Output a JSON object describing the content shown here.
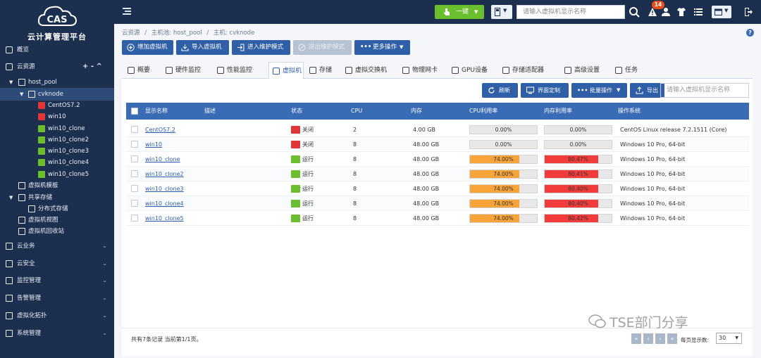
{
  "app": {
    "title": "云计算管理平台",
    "logo_text": "CAS"
  },
  "sidebar": {
    "items": [
      {
        "label": "概览",
        "icon": "home-icon"
      },
      {
        "label": "云资源",
        "icon": "cloud-resource-icon",
        "actions": "+ - ^"
      },
      {
        "label": "host_pool",
        "icon": "host-pool-icon"
      },
      {
        "label": "cvknode",
        "icon": "cvknode-icon",
        "selected": true
      },
      {
        "label": "CentOS7.2",
        "status": "stopped"
      },
      {
        "label": "win10",
        "status": "stopped"
      },
      {
        "label": "win10_clone",
        "status": "running"
      },
      {
        "label": "win10_clone2",
        "status": "running"
      },
      {
        "label": "win10_clone3",
        "status": "running"
      },
      {
        "label": "win10_clone4",
        "status": "running"
      },
      {
        "label": "win10_clone5",
        "status": "running"
      },
      {
        "label": "虚拟机模板"
      },
      {
        "label": "共享存储"
      },
      {
        "label": "分布式存储"
      },
      {
        "label": "虚拟机视图"
      },
      {
        "label": "虚拟机回收站"
      },
      {
        "label": "云业务"
      },
      {
        "label": "云安全"
      },
      {
        "label": "监控管理"
      },
      {
        "label": "告警管理"
      },
      {
        "label": "虚拟化拓扑"
      },
      {
        "label": "系统管理"
      }
    ]
  },
  "topbar": {
    "one_key": "一键",
    "search_placeholder": "请输入虚拟机显示名称",
    "alert_count": "14"
  },
  "breadcrumb": [
    "云资源",
    "/",
    "主机池: host_pool",
    "/",
    "主机: cvknode"
  ],
  "toolbar": {
    "add_vm": "增加虚拟机",
    "import_vm": "导入虚拟机",
    "enter_maintenance": "进入维护模式",
    "exit_maintenance": "退出维护模式",
    "more_ops": "更多操作"
  },
  "tabs": [
    "概要",
    "硬件监控",
    "性能监控",
    "虚拟机",
    "存储",
    "虚拟交换机",
    "物理网卡",
    "GPU设备",
    "存储适配器",
    "高级设置",
    "任务"
  ],
  "panel": {
    "refresh": "刷新",
    "ui_custom": "界面定制",
    "batch_ops": "批量操作",
    "export": "导出",
    "search_placeholder": "请输入虚拟机显示名称"
  },
  "table": {
    "headers": [
      "显示名称",
      "描述",
      "状态",
      "CPU",
      "内存",
      "CPU利用率",
      "内存利用率",
      "操作系统"
    ],
    "rows": [
      {
        "name": "CentOS7.2",
        "desc": "",
        "status": "关闭",
        "cpu": "2",
        "mem": "4.00 GB",
        "cpu_util": "0.00%",
        "cpu_pct": 0,
        "mem_util": "0.00%",
        "mem_pct": 0,
        "os": "CentOS Linux release 7.2.1511 (Core)"
      },
      {
        "name": "win10",
        "desc": "",
        "status": "关闭",
        "cpu": "8",
        "mem": "48.00 GB",
        "cpu_util": "0.00%",
        "cpu_pct": 0,
        "mem_util": "0.00%",
        "mem_pct": 0,
        "os": "Windows 10 Pro, 64-bit"
      },
      {
        "name": "win10_clone",
        "desc": "",
        "status": "运行",
        "cpu": "8",
        "mem": "48.00 GB",
        "cpu_util": "74.00%",
        "cpu_pct": 74,
        "mem_util": "80.47%",
        "mem_pct": 80.47,
        "os": "Windows 10 Pro, 64-bit"
      },
      {
        "name": "win10_clone2",
        "desc": "",
        "status": "运行",
        "cpu": "8",
        "mem": "48.00 GB",
        "cpu_util": "74.00%",
        "cpu_pct": 74,
        "mem_util": "80.41%",
        "mem_pct": 80.41,
        "os": "Windows 10 Pro, 64-bit"
      },
      {
        "name": "win10_clone3",
        "desc": "",
        "status": "运行",
        "cpu": "8",
        "mem": "48.00 GB",
        "cpu_util": "74.00%",
        "cpu_pct": 74,
        "mem_util": "80.40%",
        "mem_pct": 80.4,
        "os": "Windows 10 Pro, 64-bit"
      },
      {
        "name": "win10_clone4",
        "desc": "",
        "status": "运行",
        "cpu": "8",
        "mem": "48.00 GB",
        "cpu_util": "74.00%",
        "cpu_pct": 74,
        "mem_util": "80.40%",
        "mem_pct": 80.4,
        "os": "Windows 10 Pro, 64-bit"
      },
      {
        "name": "win10_clone5",
        "desc": "",
        "status": "运行",
        "cpu": "8",
        "mem": "48.00 GB",
        "cpu_util": "74.00%",
        "cpu_pct": 74,
        "mem_util": "80.42%",
        "mem_pct": 80.42,
        "os": "Windows 10 Pro, 64-bit"
      }
    ]
  },
  "footer": {
    "records": "共有7条记录 当前第1/1页。",
    "per_page_label": "每页显示数:",
    "per_page_value": "30"
  },
  "watermark": "TSE部门分享",
  "colors": {
    "sidebar": "#1c2f4f",
    "accent": "#2f5fa7",
    "header": "#3a6cb6",
    "cpu_bar": "#f7a53b",
    "mem_bar": "#f23b3b",
    "running": "#6bbf2e",
    "stopped": "#e23636"
  }
}
